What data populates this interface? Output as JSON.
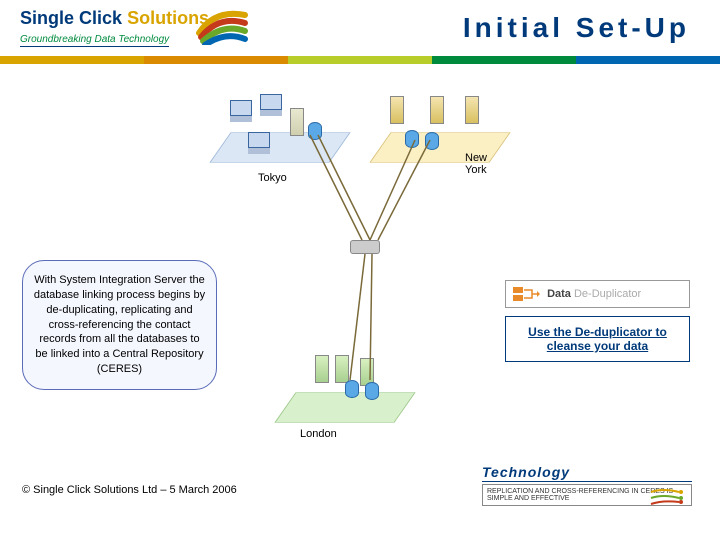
{
  "header": {
    "logo_word1": "Single",
    "logo_word2": "Click",
    "logo_word3": "Solutions",
    "logo_tagline": "Groundbreaking Data Technology",
    "page_title": "Initial Set-Up"
  },
  "diagram": {
    "site1": "Tokyo",
    "site2": "New York",
    "site3": "London"
  },
  "bubble": {
    "text": "With System Integration Server the database linking process begins by de-duplicating, replicating and cross-referencing the contact records from all the databases to be linked into a Central Repository (CERES)"
  },
  "dedup_panel": {
    "label_brand": "Data",
    "label_suffix": "De-Duplicator"
  },
  "dedup_callout": "Use the De-duplicator to cleanse your data",
  "tech": {
    "title": "Technology",
    "subtext": "REPLICATION AND CROSS-REFERENCING IN CERES IS SIMPLE AND EFFECTIVE"
  },
  "footer": "© Single Click Solutions Ltd – 5 March 2006"
}
